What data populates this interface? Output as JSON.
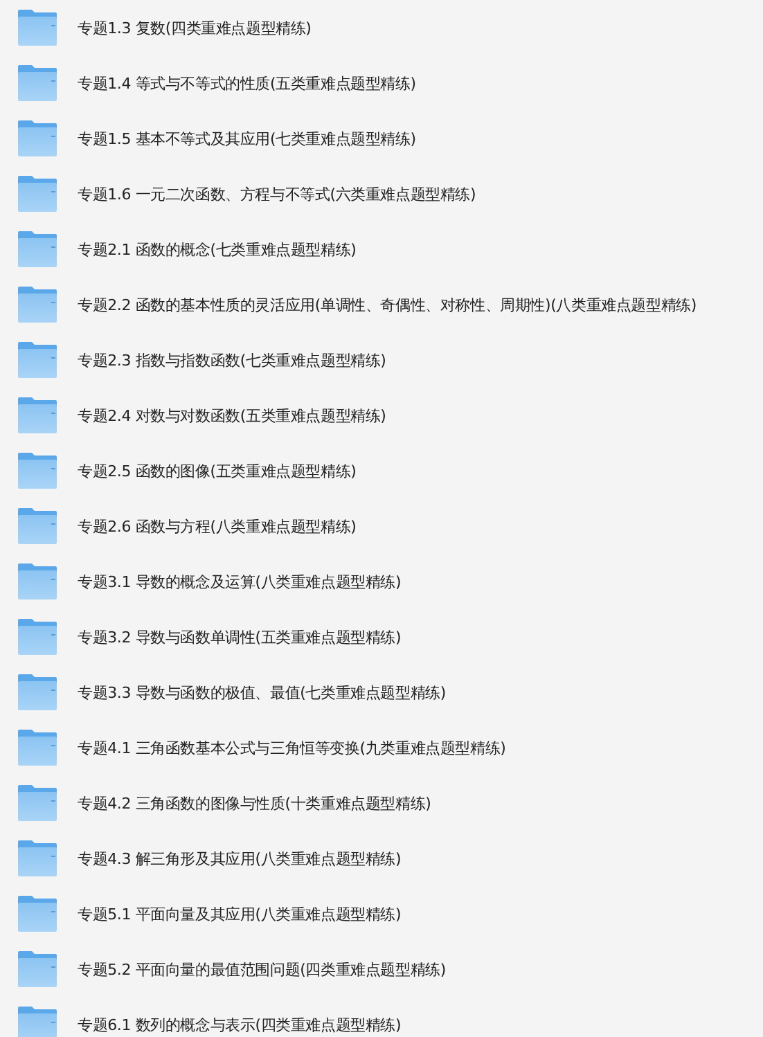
{
  "folders": [
    {
      "name": "专题1.3 复数(四类重难点题型精练)"
    },
    {
      "name": "专题1.4 等式与不等式的性质(五类重难点题型精练)"
    },
    {
      "name": "专题1.5 基本不等式及其应用(七类重难点题型精练)"
    },
    {
      "name": "专题1.6 一元二次函数、方程与不等式(六类重难点题型精练)"
    },
    {
      "name": "专题2.1 函数的概念(七类重难点题型精练)"
    },
    {
      "name": "专题2.2 函数的基本性质的灵活应用(单调性、奇偶性、对称性、周期性)(八类重难点题型精练)"
    },
    {
      "name": "专题2.3 指数与指数函数(七类重难点题型精练)"
    },
    {
      "name": "专题2.4 对数与对数函数(五类重难点题型精练)"
    },
    {
      "name": "专题2.5 函数的图像(五类重难点题型精练)"
    },
    {
      "name": "专题2.6 函数与方程(八类重难点题型精练)"
    },
    {
      "name": "专题3.1 导数的概念及运算(八类重难点题型精练)"
    },
    {
      "name": "专题3.2 导数与函数单调性(五类重难点题型精练)"
    },
    {
      "name": "专题3.3 导数与函数的极值、最值(七类重难点题型精练)"
    },
    {
      "name": "专题4.1 三角函数基本公式与三角恒等变换(九类重难点题型精练)"
    },
    {
      "name": "专题4.2 三角函数的图像与性质(十类重难点题型精练)"
    },
    {
      "name": "专题4.3 解三角形及其应用(八类重难点题型精练)"
    },
    {
      "name": "专题5.1 平面向量及其应用(八类重难点题型精练)"
    },
    {
      "name": "专题5.2 平面向量的最值范围问题(四类重难点题型精练)"
    },
    {
      "name": "专题6.1 数列的概念与表示(四类重难点题型精练)"
    }
  ]
}
